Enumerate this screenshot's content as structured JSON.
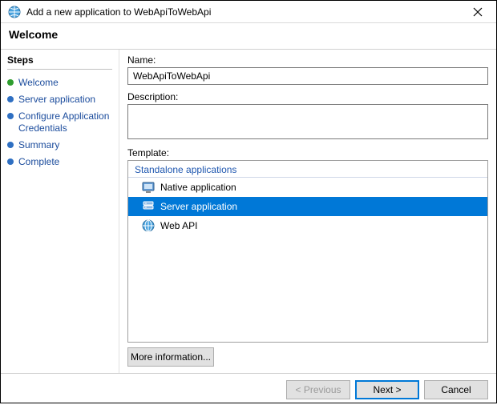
{
  "titlebar": {
    "text": "Add a new application to WebApiToWebApi"
  },
  "header": {
    "title": "Welcome"
  },
  "sidebar": {
    "heading": "Steps",
    "items": [
      {
        "label": "Welcome",
        "state": "done"
      },
      {
        "label": "Server application",
        "state": "todo"
      },
      {
        "label": "Configure Application Credentials",
        "state": "todo"
      },
      {
        "label": "Summary",
        "state": "todo"
      },
      {
        "label": "Complete",
        "state": "todo"
      }
    ]
  },
  "form": {
    "name_label": "Name:",
    "name_value": "WebApiToWebApi",
    "description_label": "Description:",
    "description_value": "",
    "template_label": "Template:",
    "group_header": "Standalone applications",
    "templates": [
      {
        "label": "Native application",
        "icon": "native-app-icon",
        "selected": false
      },
      {
        "label": "Server application",
        "icon": "server-app-icon",
        "selected": true
      },
      {
        "label": "Web API",
        "icon": "web-api-icon",
        "selected": false
      }
    ],
    "more_info": "More information..."
  },
  "footer": {
    "previous": "< Previous",
    "next": "Next >",
    "cancel": "Cancel"
  }
}
